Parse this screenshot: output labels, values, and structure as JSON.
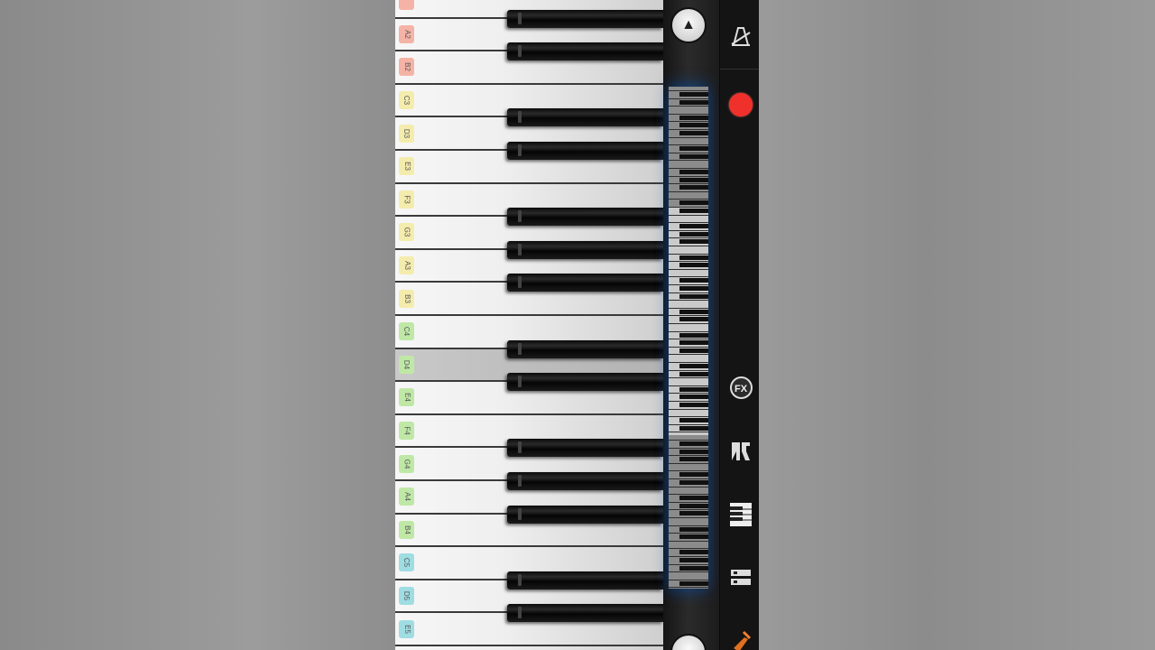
{
  "keyboard": {
    "white_keys": [
      {
        "note": "",
        "color": "#f5b3a6"
      },
      {
        "note": "A2",
        "color": "#f5b3a6"
      },
      {
        "note": "B2",
        "color": "#f5b3a6"
      },
      {
        "note": "C3",
        "color": "#f4ecac"
      },
      {
        "note": "D3",
        "color": "#f4ecac"
      },
      {
        "note": "E3",
        "color": "#f4ecac"
      },
      {
        "note": "F3",
        "color": "#f4ecac"
      },
      {
        "note": "G3",
        "color": "#f4ecac"
      },
      {
        "note": "A3",
        "color": "#f4ecac"
      },
      {
        "note": "B3",
        "color": "#f4ecac"
      },
      {
        "note": "C4",
        "color": "#bfe8a6"
      },
      {
        "note": "D4",
        "color": "#bfe8a6",
        "pressed": true
      },
      {
        "note": "E4",
        "color": "#bfe8a6"
      },
      {
        "note": "F4",
        "color": "#bfe8a6"
      },
      {
        "note": "G4",
        "color": "#bfe8a6"
      },
      {
        "note": "A4",
        "color": "#bfe8a6"
      },
      {
        "note": "B4",
        "color": "#bfe8a6"
      },
      {
        "note": "C5",
        "color": "#9fdde2"
      },
      {
        "note": "D5",
        "color": "#9fdde2"
      },
      {
        "note": "E5",
        "color": "#9fdde2"
      },
      {
        "note": "",
        "color": "#9fdde2"
      }
    ],
    "black_key_after": [
      "",
      "A2",
      "C3",
      "D3",
      "F3",
      "G3",
      "A3",
      "C4",
      "D4",
      "F4",
      "G4",
      "A4",
      "C5",
      "D5"
    ]
  },
  "scroller": {
    "up_icon": "triangle-up-icon",
    "down_icon": "scroll-down-icon"
  },
  "sidebar": {
    "buttons": [
      {
        "name": "metronome-button",
        "icon": "metronome-icon"
      },
      {
        "name": "record-button",
        "icon": "record-icon",
        "color": "#f0302a"
      },
      {
        "name": "fx-button",
        "icon": "fx-icon",
        "label": "FX"
      },
      {
        "name": "split-button",
        "icon": "split-keys-icon"
      },
      {
        "name": "keyboard-layout-button",
        "icon": "keyboard-icon"
      },
      {
        "name": "settings-button",
        "icon": "sliders-icon"
      },
      {
        "name": "instrument-button",
        "icon": "instrument-icon"
      }
    ]
  }
}
